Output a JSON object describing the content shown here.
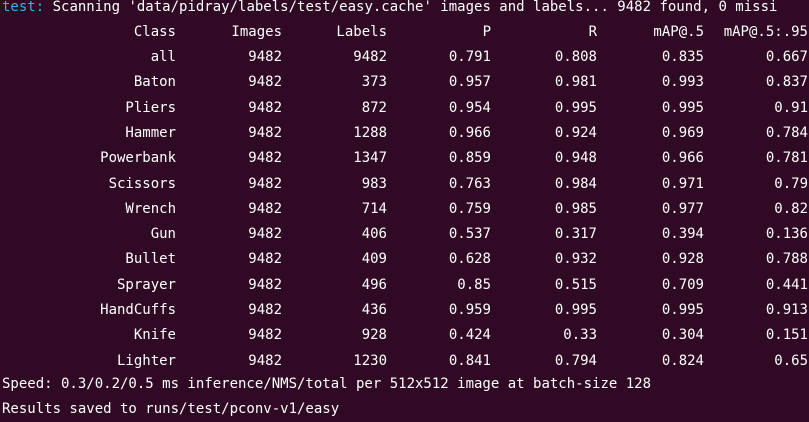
{
  "scan": {
    "prefix": "test:",
    "message": " Scanning 'data/pidray/labels/test/easy.cache' images and labels... 9482 found, 0 missi"
  },
  "table": {
    "headers": [
      "Class",
      "Images",
      "Labels",
      "P",
      "R",
      "mAP@.5",
      "mAP@.5:.95"
    ],
    "rows": [
      [
        "all",
        "9482",
        "9482",
        "0.791",
        "0.808",
        "0.835",
        "0.667"
      ],
      [
        "Baton",
        "9482",
        "373",
        "0.957",
        "0.981",
        "0.993",
        "0.837"
      ],
      [
        "Pliers",
        "9482",
        "872",
        "0.954",
        "0.995",
        "0.995",
        "0.91"
      ],
      [
        "Hammer",
        "9482",
        "1288",
        "0.966",
        "0.924",
        "0.969",
        "0.784"
      ],
      [
        "Powerbank",
        "9482",
        "1347",
        "0.859",
        "0.948",
        "0.966",
        "0.781"
      ],
      [
        "Scissors",
        "9482",
        "983",
        "0.763",
        "0.984",
        "0.971",
        "0.79"
      ],
      [
        "Wrench",
        "9482",
        "714",
        "0.759",
        "0.985",
        "0.977",
        "0.82"
      ],
      [
        "Gun",
        "9482",
        "406",
        "0.537",
        "0.317",
        "0.394",
        "0.136"
      ],
      [
        "Bullet",
        "9482",
        "409",
        "0.628",
        "0.932",
        "0.928",
        "0.788"
      ],
      [
        "Sprayer",
        "9482",
        "496",
        "0.85",
        "0.515",
        "0.709",
        "0.441"
      ],
      [
        "HandCuffs",
        "9482",
        "436",
        "0.959",
        "0.995",
        "0.995",
        "0.913"
      ],
      [
        "Knife",
        "9482",
        "928",
        "0.424",
        "0.33",
        "0.304",
        "0.151"
      ],
      [
        "Lighter",
        "9482",
        "1230",
        "0.841",
        "0.794",
        "0.824",
        "0.65"
      ]
    ]
  },
  "speed": "Speed: 0.3/0.2/0.5 ms inference/NMS/total per 512x512 image at batch-size 128",
  "results": "Results saved to runs/test/pconv-v1/easy",
  "colors": {
    "background": "#300a24",
    "text": "#ffffff",
    "prefix": "#3daee9"
  }
}
